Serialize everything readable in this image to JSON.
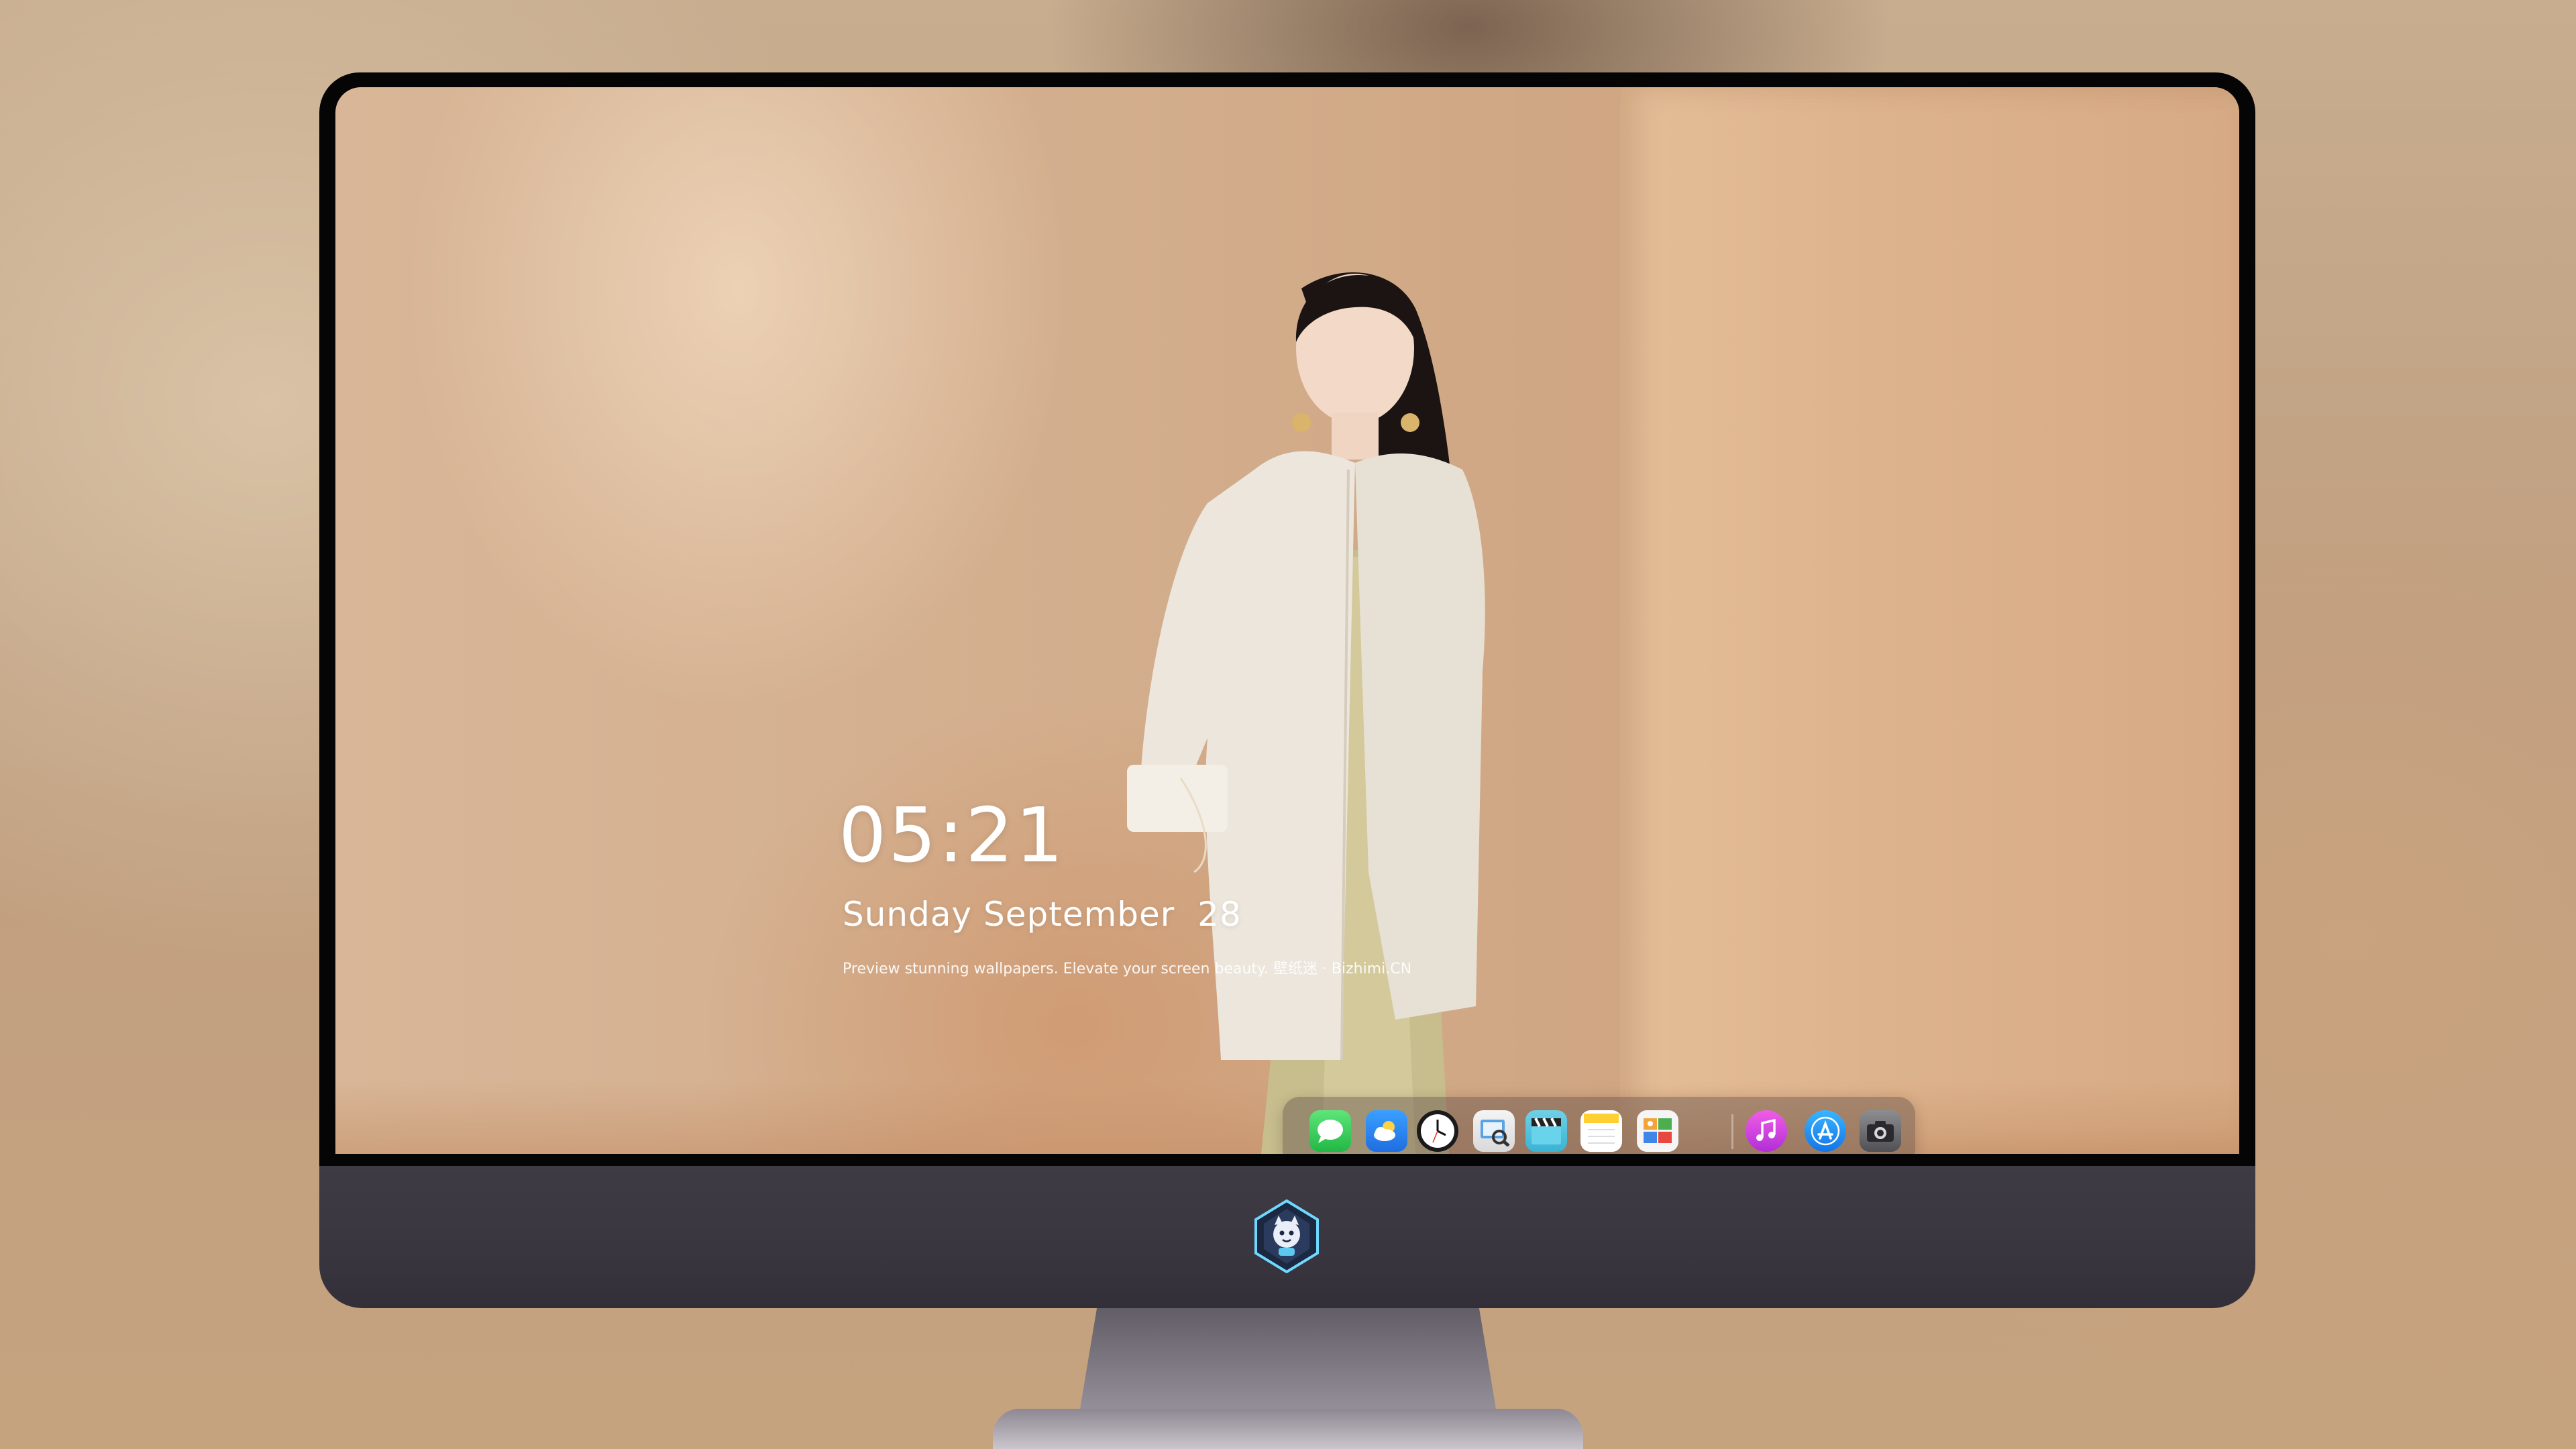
{
  "clock": {
    "time": "05:21",
    "date": "Sunday September  28",
    "tagline": "Preview stunning wallpapers. Elevate your screen beauty. 壁纸迷 · Bizhimi.CN"
  },
  "dock": {
    "items": [
      {
        "name": "messages-icon"
      },
      {
        "name": "weather-icon"
      },
      {
        "name": "clock-icon"
      },
      {
        "name": "preview-icon"
      },
      {
        "name": "clapperboard-icon"
      },
      {
        "name": "notes-icon"
      },
      {
        "name": "photo-booth-icon"
      },
      {
        "name": "music-icon"
      },
      {
        "name": "app-store-icon"
      },
      {
        "name": "camera-icon"
      }
    ]
  },
  "colors": {
    "dock_green": "#35c759",
    "dock_blue": "#2f8cf5",
    "dock_pink": "#e23ed6",
    "chin": "#3c3842",
    "bezel": "#050505"
  }
}
